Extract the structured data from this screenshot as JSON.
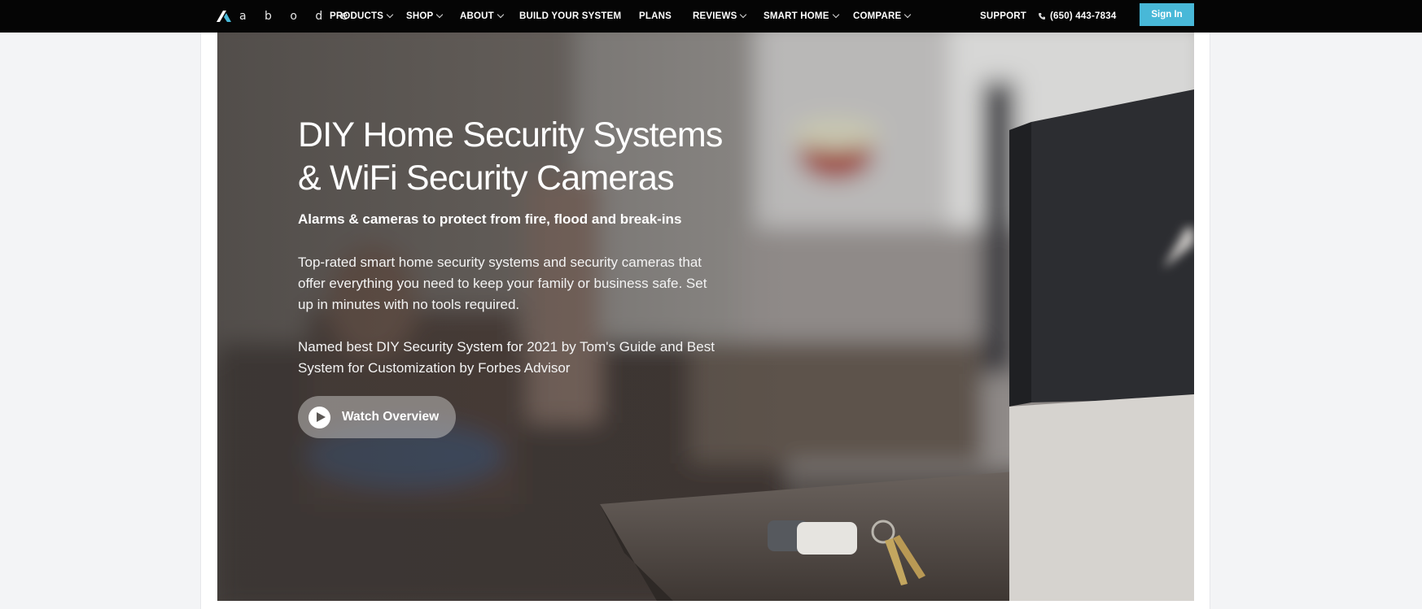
{
  "brand": {
    "name": "a b o d e"
  },
  "nav": {
    "items": [
      {
        "label": "PRODUCTS",
        "dropdown": true
      },
      {
        "label": "SHOP",
        "dropdown": true
      },
      {
        "label": "ABOUT",
        "dropdown": true
      },
      {
        "label": "BUILD YOUR SYSTEM",
        "dropdown": false
      },
      {
        "label": "PLANS",
        "dropdown": false
      },
      {
        "label": "REVIEWS",
        "dropdown": true
      },
      {
        "label": "SMART HOME",
        "dropdown": true
      },
      {
        "label": "COMPARE",
        "dropdown": true
      }
    ],
    "support": "SUPPORT",
    "phone": "(650) 443-7834",
    "sign_in": "Sign In",
    "icons": {
      "phone": "phone-icon",
      "chevron": "chevron-down-icon"
    }
  },
  "hero": {
    "title_line1": "DIY Home Security Systems",
    "title_line2": "& WiFi Security Cameras",
    "subtitle": "Alarms & cameras to protect from fire, flood and break-ins",
    "description": "Top-rated smart home security systems and security cameras that offer everything you need to keep your family or business safe. Set up in minutes with no tools required.",
    "award": "Named best DIY Security System for 2021 by Tom's Guide and Best System for Customization by Forbes Advisor",
    "watch_label": "Watch Overview",
    "icons": {
      "play": "play-icon"
    }
  },
  "colors": {
    "nav_bg": "#050505",
    "accent": "#48b8d8",
    "page_bg": "#f3f4f6"
  }
}
